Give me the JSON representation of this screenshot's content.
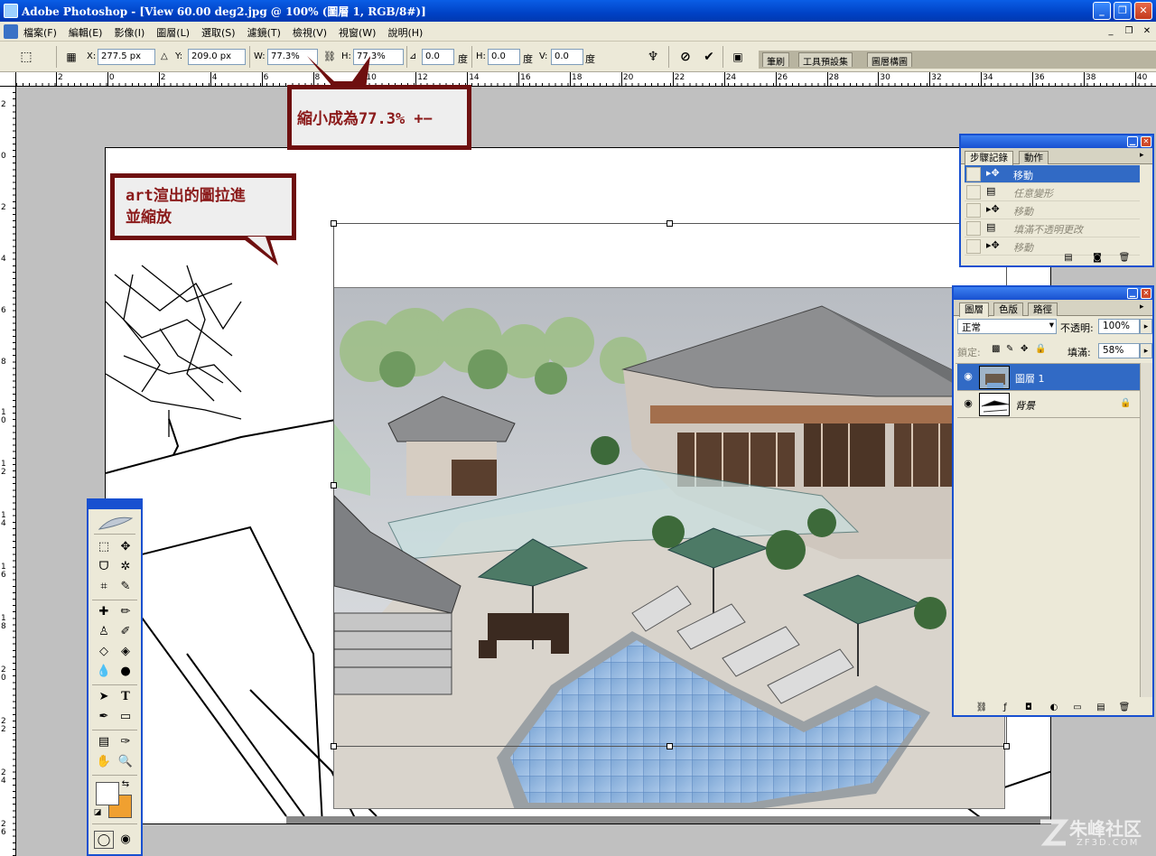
{
  "window": {
    "title": "Adobe Photoshop - [View 60.00 deg2.jpg @ 100% (圖層 1, RGB/8#)]",
    "minimize": "_",
    "maximize": "❐",
    "close": "✕"
  },
  "menu": {
    "items": [
      "檔案(F)",
      "編輯(E)",
      "影像(I)",
      "圖層(L)",
      "選取(S)",
      "濾鏡(T)",
      "檢視(V)",
      "視窗(W)",
      "說明(H)"
    ],
    "doc_minimize": "_",
    "doc_restore": "❐",
    "doc_close": "✕"
  },
  "options": {
    "x_label": "X:",
    "x_value": "277.5 px",
    "y_label": "Y:",
    "y_value": "209.0 px",
    "w_label": "W:",
    "w_value": "77.3%",
    "h_label": "H:",
    "h_value": "77.3%",
    "rotate_value": "0.0",
    "rotate_unit": "度",
    "hskew_label": "H:",
    "hskew_value": "0.0",
    "hskew_unit": "度",
    "vskew_label": "V:",
    "vskew_value": "0.0",
    "vskew_unit": "度",
    "wells": [
      "筆刷",
      "工具預設集",
      "圖層構圖"
    ]
  },
  "ruler": {
    "top": [
      "2",
      "0",
      "2",
      "4",
      "6",
      "8",
      "10",
      "12",
      "14",
      "16",
      "18",
      "20",
      "22",
      "24",
      "26",
      "28",
      "30",
      "32",
      "34",
      "36",
      "38",
      "40"
    ],
    "left": [
      "2",
      "0",
      "2",
      "4",
      "6",
      "8",
      "10",
      "12",
      "14",
      "16",
      "18",
      "20",
      "22",
      "24",
      "26"
    ]
  },
  "callouts": {
    "scale_note": "縮小成為77.3% +−",
    "art_note_line1": "art渲出的圖拉進",
    "art_note_line2": "並縮放"
  },
  "history_panel": {
    "tabs": [
      "步驟記錄",
      "動作"
    ],
    "rows": [
      {
        "label": "移動",
        "icon": "move-icon",
        "active": true
      },
      {
        "label": "任意變形",
        "icon": "document-icon",
        "active": false
      },
      {
        "label": "移動",
        "icon": "move-icon",
        "active": false
      },
      {
        "label": "填滿不透明更改",
        "icon": "document-icon",
        "active": false
      },
      {
        "label": "移動",
        "icon": "move-icon",
        "active": false
      }
    ]
  },
  "layers_panel": {
    "tabs": [
      "圖層",
      "色版",
      "路徑"
    ],
    "blend_mode": "正常",
    "opacity_label": "不透明:",
    "opacity_value": "100%",
    "lock_label": "鎖定:",
    "fill_label": "填滿:",
    "fill_value": "58%",
    "layers": [
      {
        "name": "圖層 1",
        "visible": true,
        "active": true
      },
      {
        "name": "背景",
        "visible": true,
        "active": false,
        "locked": true
      }
    ]
  },
  "toolbox": {
    "tools": [
      "marquee-tool",
      "move-tool",
      "lasso-tool",
      "magic-wand-tool",
      "crop-tool",
      "slice-tool",
      "healing-brush-tool",
      "brush-tool",
      "clone-stamp-tool",
      "history-brush-tool",
      "eraser-tool",
      "paint-bucket-tool",
      "blur-tool",
      "dodge-tool",
      "path-selection-tool",
      "type-tool",
      "pen-tool",
      "rectangle-tool",
      "notes-tool",
      "eyedropper-tool",
      "hand-tool",
      "zoom-tool"
    ],
    "foreground_color": "#ffffff",
    "background_color": "#f0a030"
  },
  "watermark": {
    "text": "朱峰社区",
    "url": "ZF3D.COM"
  },
  "colors": {
    "titlebar": "#0a5ee6",
    "callout_border": "#6e0f0f",
    "callout_text": "#8b1a1a",
    "selection": "#316ac5",
    "panel_bg": "#ece9d8"
  }
}
